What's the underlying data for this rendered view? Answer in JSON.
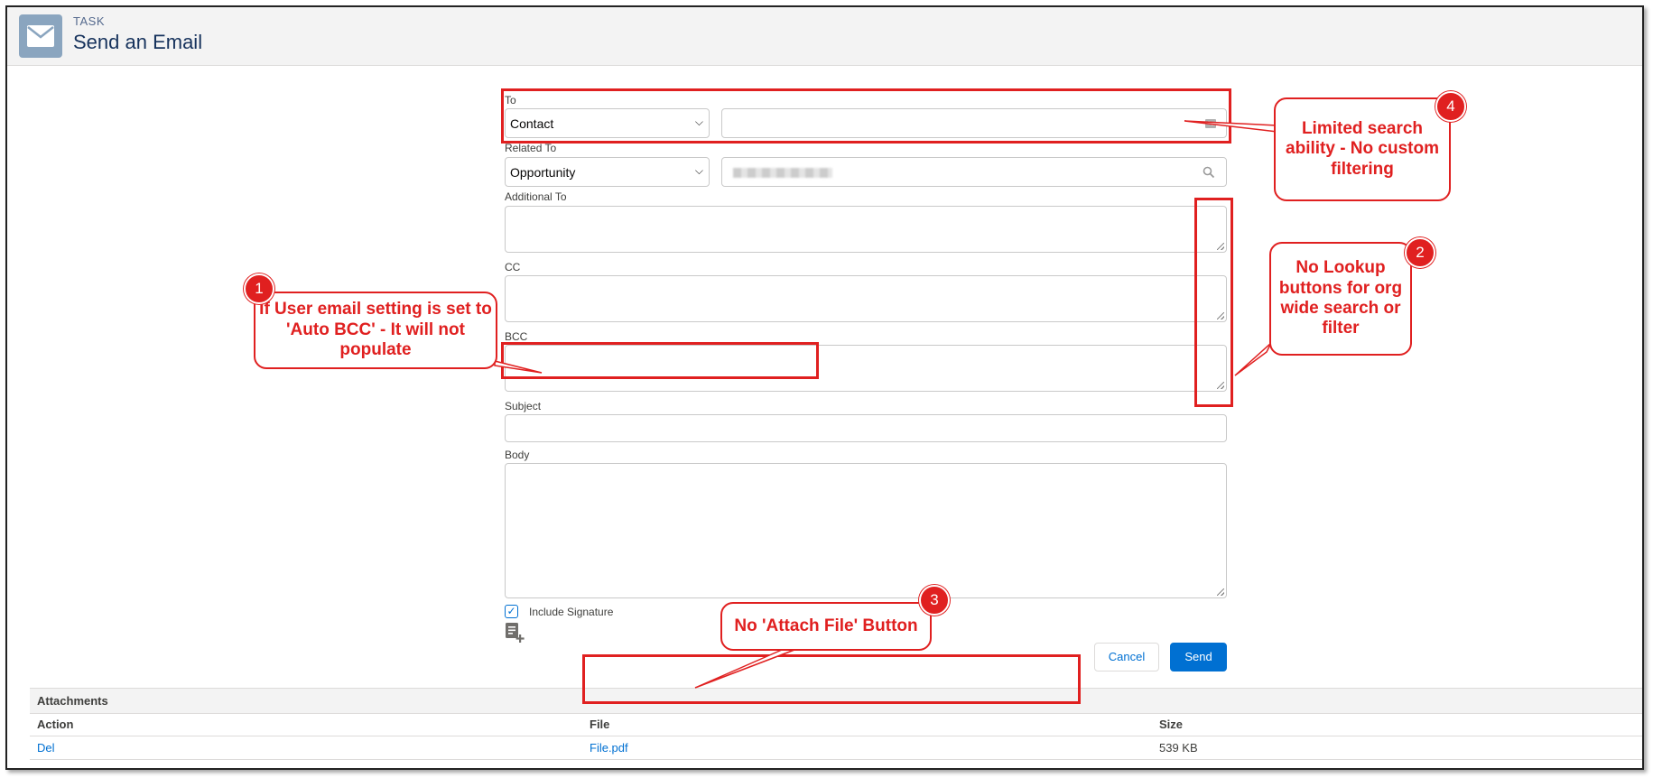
{
  "header": {
    "category": "TASK",
    "title": "Send an Email",
    "icon": "envelope-icon"
  },
  "form": {
    "to": {
      "label": "To",
      "select_value": "Contact",
      "input_value": ""
    },
    "related_to": {
      "label": "Related To",
      "select_value": "Opportunity"
    },
    "additional_to": {
      "label": "Additional To",
      "value": ""
    },
    "cc": {
      "label": "CC",
      "value": ""
    },
    "bcc": {
      "label": "BCC",
      "value": ""
    },
    "subject": {
      "label": "Subject",
      "value": ""
    },
    "body": {
      "label": "Body",
      "value": ""
    },
    "include_signature": {
      "label": "Include Signature",
      "checked": true
    }
  },
  "buttons": {
    "cancel": "Cancel",
    "send": "Send"
  },
  "attachments": {
    "title": "Attachments",
    "columns": [
      "Action",
      "File",
      "Size"
    ],
    "rows": [
      {
        "action": "Del",
        "file": "File.pdf",
        "size": "539 KB"
      }
    ]
  },
  "annotations": {
    "color": "#e02020",
    "callouts": [
      {
        "number": "1",
        "text": "If User email setting is set to 'Auto BCC' - It will not populate"
      },
      {
        "number": "2",
        "text": "No Lookup buttons for org wide search or filter"
      },
      {
        "number": "3",
        "text": "No 'Attach File' Button"
      },
      {
        "number": "4",
        "text": "Limited search ability - No custom filtering"
      }
    ]
  },
  "colors": {
    "brand_blue": "#0070d2",
    "header_bg": "#f3f3f3",
    "icon_bg": "#8aa5bf"
  }
}
